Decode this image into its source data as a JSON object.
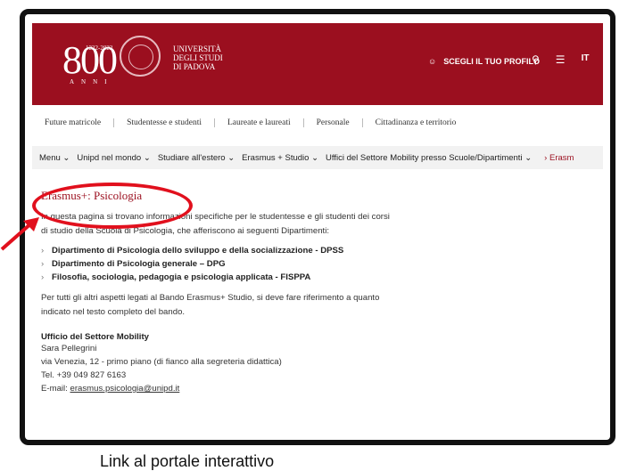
{
  "header": {
    "years": "1222-2022",
    "logo_number": "800",
    "logo_anni": "ANNI",
    "university_line1": "UNIVERSITÀ",
    "university_line2": "DEGLI STUDI",
    "university_line3": "DI PADOVA",
    "profile_label": "SCEGLI IL TUO PROFILO",
    "lang": "IT"
  },
  "audience_nav": [
    "Future matricole",
    "Studentesse e studenti",
    "Laureate e laureati",
    "Personale",
    "Cittadinanza e territorio"
  ],
  "menu": {
    "items": [
      "Menu",
      "Unipd nel mondo",
      "Studiare all'estero",
      "Erasmus + Studio",
      "Uffici del Settore Mobility presso Scuole/Dipartimenti"
    ],
    "current": "Erasm"
  },
  "content": {
    "title": "Erasmus+: Psicologia",
    "intro": "In questa pagina si trovano informazioni specifiche per le studentesse e gli studenti dei corsi di studio della Scuola di Psicologia, che afferiscono ai seguenti Dipartimenti:",
    "departments": [
      "Dipartimento di Psicologia dello sviluppo e della socializzazione - DPSS",
      "Dipartimento di Psicologia generale – DPG",
      "Filosofia, sociologia, pedagogia e psicologia applicata - FISPPA"
    ],
    "note": "Per tutti gli altri aspetti legati al Bando Erasmus+ Studio, si deve fare riferimento a quanto indicato nel testo completo del bando.",
    "office_title": "Ufficio del Settore Mobility",
    "contact_name": "Sara Pellegrini",
    "address": "via Venezia, 12 - primo piano (di fianco alla segreteria didattica)",
    "phone": "Tel. +39 049 827 6163",
    "email_label": "E-mail: ",
    "email": "erasmus.psicologia@unipd.it"
  },
  "caption": "Link al portale interattivo",
  "colors": {
    "brand": "#9b0f1f",
    "annotation": "#e1101d"
  }
}
